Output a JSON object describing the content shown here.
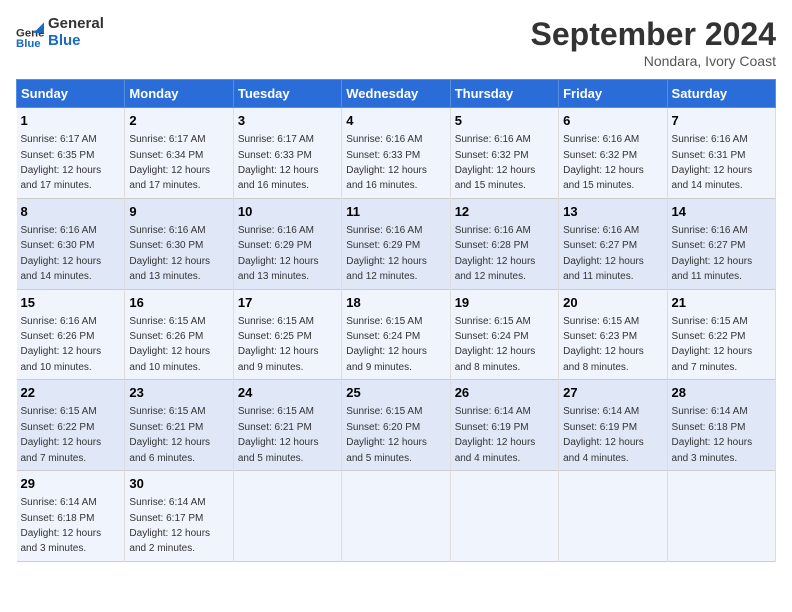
{
  "header": {
    "logo_line1": "General",
    "logo_line2": "Blue",
    "month": "September 2024",
    "location": "Nondara, Ivory Coast"
  },
  "weekdays": [
    "Sunday",
    "Monday",
    "Tuesday",
    "Wednesday",
    "Thursday",
    "Friday",
    "Saturday"
  ],
  "weeks": [
    [
      {
        "day": "1",
        "rise": "6:17 AM",
        "set": "6:35 PM",
        "daylight": "12 hours and 17 minutes."
      },
      {
        "day": "2",
        "rise": "6:17 AM",
        "set": "6:34 PM",
        "daylight": "12 hours and 17 minutes."
      },
      {
        "day": "3",
        "rise": "6:17 AM",
        "set": "6:33 PM",
        "daylight": "12 hours and 16 minutes."
      },
      {
        "day": "4",
        "rise": "6:16 AM",
        "set": "6:33 PM",
        "daylight": "12 hours and 16 minutes."
      },
      {
        "day": "5",
        "rise": "6:16 AM",
        "set": "6:32 PM",
        "daylight": "12 hours and 15 minutes."
      },
      {
        "day": "6",
        "rise": "6:16 AM",
        "set": "6:32 PM",
        "daylight": "12 hours and 15 minutes."
      },
      {
        "day": "7",
        "rise": "6:16 AM",
        "set": "6:31 PM",
        "daylight": "12 hours and 14 minutes."
      }
    ],
    [
      {
        "day": "8",
        "rise": "6:16 AM",
        "set": "6:30 PM",
        "daylight": "12 hours and 14 minutes."
      },
      {
        "day": "9",
        "rise": "6:16 AM",
        "set": "6:30 PM",
        "daylight": "12 hours and 13 minutes."
      },
      {
        "day": "10",
        "rise": "6:16 AM",
        "set": "6:29 PM",
        "daylight": "12 hours and 13 minutes."
      },
      {
        "day": "11",
        "rise": "6:16 AM",
        "set": "6:29 PM",
        "daylight": "12 hours and 12 minutes."
      },
      {
        "day": "12",
        "rise": "6:16 AM",
        "set": "6:28 PM",
        "daylight": "12 hours and 12 minutes."
      },
      {
        "day": "13",
        "rise": "6:16 AM",
        "set": "6:27 PM",
        "daylight": "12 hours and 11 minutes."
      },
      {
        "day": "14",
        "rise": "6:16 AM",
        "set": "6:27 PM",
        "daylight": "12 hours and 11 minutes."
      }
    ],
    [
      {
        "day": "15",
        "rise": "6:16 AM",
        "set": "6:26 PM",
        "daylight": "12 hours and 10 minutes."
      },
      {
        "day": "16",
        "rise": "6:15 AM",
        "set": "6:26 PM",
        "daylight": "12 hours and 10 minutes."
      },
      {
        "day": "17",
        "rise": "6:15 AM",
        "set": "6:25 PM",
        "daylight": "12 hours and 9 minutes."
      },
      {
        "day": "18",
        "rise": "6:15 AM",
        "set": "6:24 PM",
        "daylight": "12 hours and 9 minutes."
      },
      {
        "day": "19",
        "rise": "6:15 AM",
        "set": "6:24 PM",
        "daylight": "12 hours and 8 minutes."
      },
      {
        "day": "20",
        "rise": "6:15 AM",
        "set": "6:23 PM",
        "daylight": "12 hours and 8 minutes."
      },
      {
        "day": "21",
        "rise": "6:15 AM",
        "set": "6:22 PM",
        "daylight": "12 hours and 7 minutes."
      }
    ],
    [
      {
        "day": "22",
        "rise": "6:15 AM",
        "set": "6:22 PM",
        "daylight": "12 hours and 7 minutes."
      },
      {
        "day": "23",
        "rise": "6:15 AM",
        "set": "6:21 PM",
        "daylight": "12 hours and 6 minutes."
      },
      {
        "day": "24",
        "rise": "6:15 AM",
        "set": "6:21 PM",
        "daylight": "12 hours and 5 minutes."
      },
      {
        "day": "25",
        "rise": "6:15 AM",
        "set": "6:20 PM",
        "daylight": "12 hours and 5 minutes."
      },
      {
        "day": "26",
        "rise": "6:14 AM",
        "set": "6:19 PM",
        "daylight": "12 hours and 4 minutes."
      },
      {
        "day": "27",
        "rise": "6:14 AM",
        "set": "6:19 PM",
        "daylight": "12 hours and 4 minutes."
      },
      {
        "day": "28",
        "rise": "6:14 AM",
        "set": "6:18 PM",
        "daylight": "12 hours and 3 minutes."
      }
    ],
    [
      {
        "day": "29",
        "rise": "6:14 AM",
        "set": "6:18 PM",
        "daylight": "12 hours and 3 minutes."
      },
      {
        "day": "30",
        "rise": "6:14 AM",
        "set": "6:17 PM",
        "daylight": "12 hours and 2 minutes."
      },
      null,
      null,
      null,
      null,
      null
    ]
  ],
  "labels": {
    "sunrise": "Sunrise:",
    "sunset": "Sunset:",
    "daylight": "Daylight:"
  }
}
